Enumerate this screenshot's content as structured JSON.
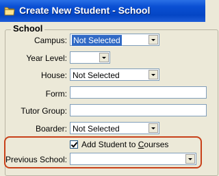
{
  "window": {
    "title": "Create New Student - School"
  },
  "group": {
    "title": "School"
  },
  "fields": {
    "campus": {
      "label": "Campus:",
      "value": "Not Selected"
    },
    "year_level": {
      "label": "Year Level:",
      "value": ""
    },
    "house": {
      "label": "House:",
      "value": "Not Selected"
    },
    "form": {
      "label": "Form:",
      "value": ""
    },
    "tutor_group": {
      "label": "Tutor Group:",
      "value": ""
    },
    "boarder": {
      "label": "Boarder:",
      "value": "Not Selected"
    },
    "add_to_courses": {
      "label_prefix": "Add Student to ",
      "label_underlined": "C",
      "label_suffix": "ourses",
      "checked": true
    },
    "previous_school": {
      "label": "Previous School:",
      "value": ""
    }
  },
  "colors": {
    "titlebar": "#0446c5",
    "highlight_border": "#c84018",
    "selection": "#316ac5"
  },
  "icons": {
    "title_icon": "folder-icon"
  }
}
